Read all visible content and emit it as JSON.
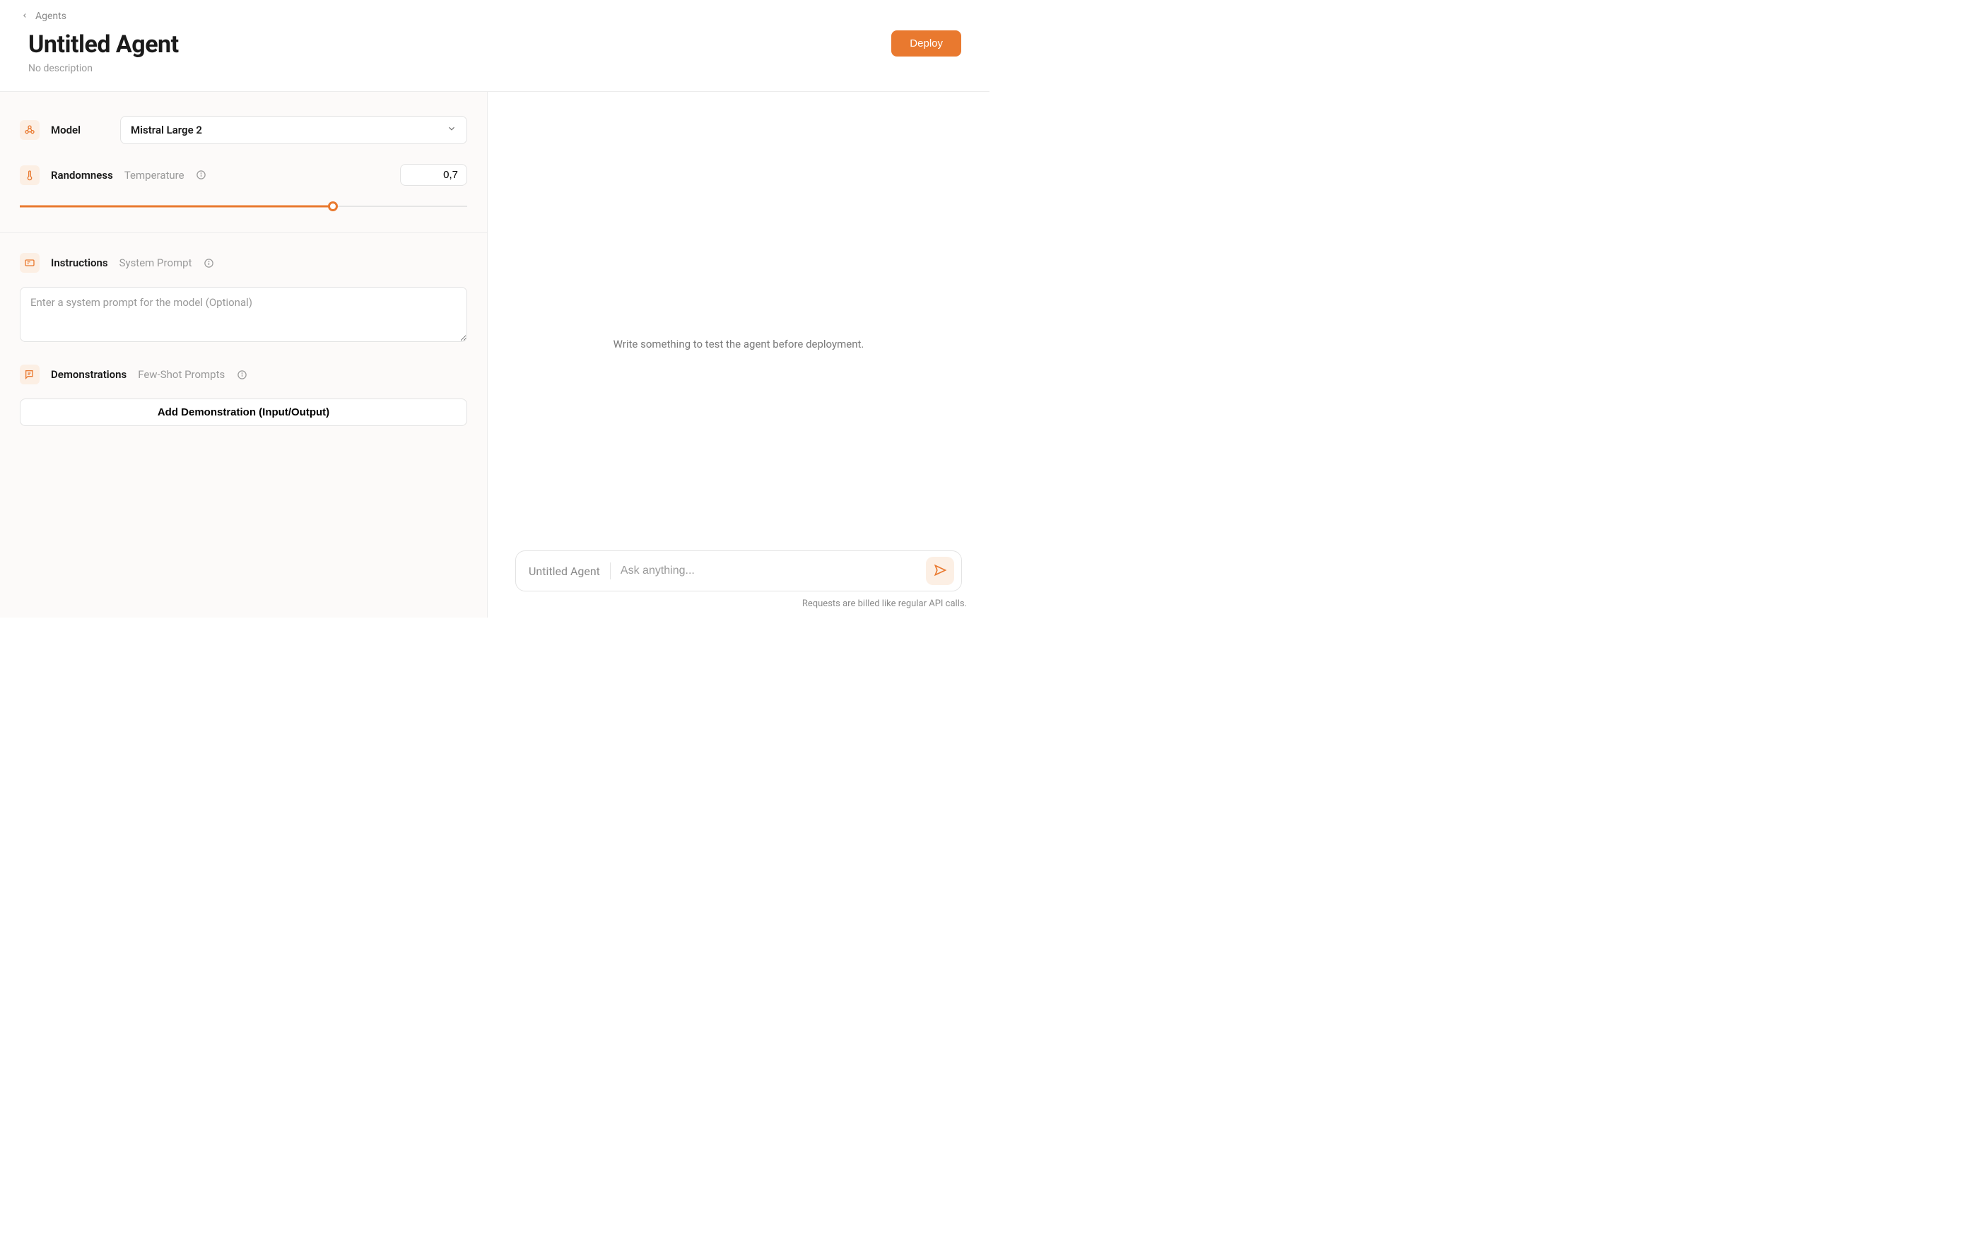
{
  "breadcrumb": {
    "label": "Agents"
  },
  "header": {
    "title": "Untitled Agent",
    "subtitle": "No description",
    "deploy_label": "Deploy"
  },
  "model": {
    "label": "Model",
    "selected": "Mistral Large 2"
  },
  "randomness": {
    "label": "Randomness",
    "sub": "Temperature",
    "value": "0,7",
    "slider_percent": 70
  },
  "instructions": {
    "label": "Instructions",
    "sub": "System Prompt",
    "placeholder": "Enter a system prompt for the model (Optional)"
  },
  "demonstrations": {
    "label": "Demonstrations",
    "sub": "Few-Shot Prompts",
    "add_label": "Add Demonstration (Input/Output)"
  },
  "playground": {
    "empty": "Write something to test the agent before deployment.",
    "agent_label": "Untitled Agent",
    "input_placeholder": "Ask anything...",
    "billing_note": "Requests are billed like regular API calls."
  }
}
